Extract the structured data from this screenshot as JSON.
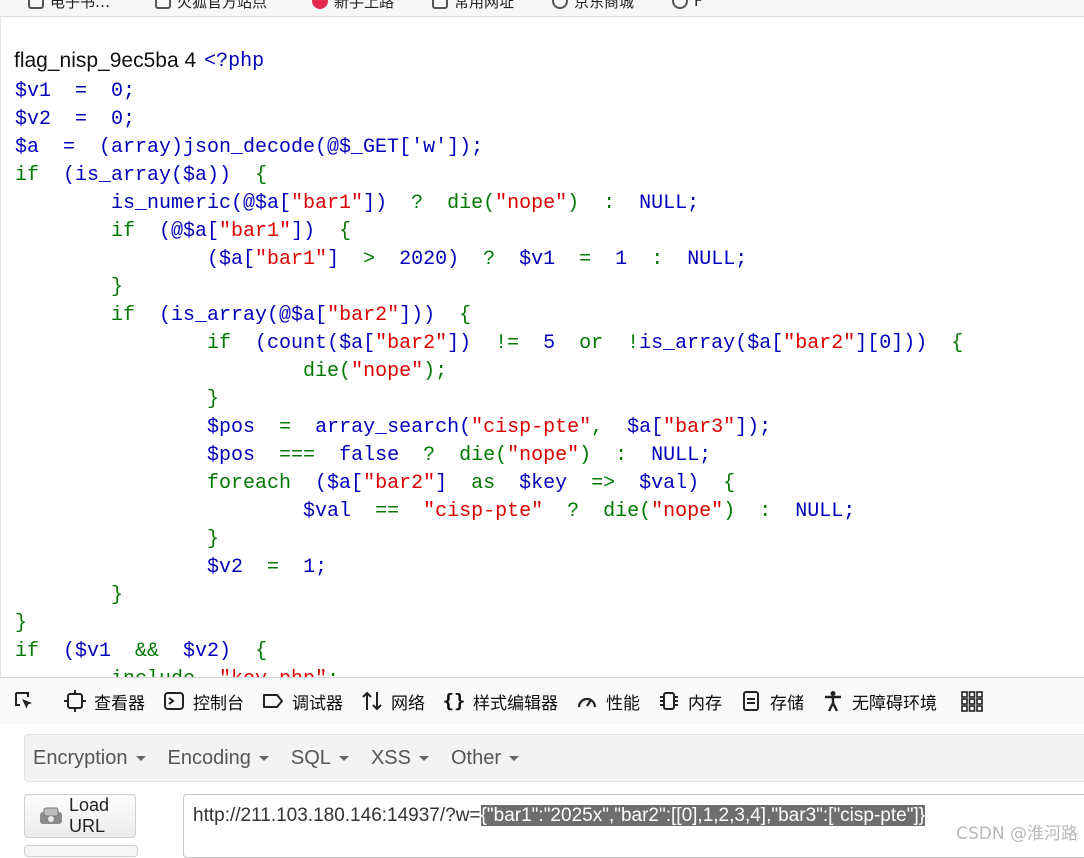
{
  "bookmarks": [
    {
      "label": "电子书…",
      "icon": "folder-icon"
    },
    {
      "label": "火狐官方站点",
      "icon": "folder-icon"
    },
    {
      "label": "新手上路",
      "icon": "firefox-icon"
    },
    {
      "label": "常用网址",
      "icon": "folder-icon"
    },
    {
      "label": "京东商城",
      "icon": "globe-icon"
    },
    {
      "label": "F",
      "icon": "globe-icon"
    }
  ],
  "page": {
    "flag_text": "flag_nisp_9ec5ba 4",
    "php_open": "<?php",
    "code": {
      "l1": "$v1  =  0;",
      "l2": "$v2  =  0;",
      "l3": "$a  =  (array)json_decode(@$_GET['w']);",
      "l4_kw": "if",
      "l4_rest": "  (is_array($a))  ",
      "l4_brace": "{",
      "l5_pre": "        is_numeric(@$a[",
      "l5_s": "\"bar1\"",
      "l5_mid": "])  ",
      "l5_q": "?",
      "l5_die": "  die(",
      "l5_s2": "\"nope\"",
      "l5_close": ")  ",
      "l5_colon": ":",
      "l5_end": "  NULL;",
      "l6_kw": "        if",
      "l6_rest": "  (@$a[",
      "l6_s": "\"bar1\"",
      "l6_close": "])  ",
      "l6_brace": "{",
      "l7_pre": "                ($a[",
      "l7_s": "\"bar1\"",
      "l7_mid": "]  ",
      "l7_gt": ">",
      "l7_num": "  2020)  ",
      "l7_q": "?",
      "l7_v": "  $v1  ",
      "l7_eq": "=",
      "l7_one": "  1  ",
      "l7_colon": ":",
      "l7_end": "  NULL;",
      "l8": "        }",
      "l9_kw": "        if",
      "l9_rest": "  (is_array(@$a[",
      "l9_s": "\"bar2\"",
      "l9_close": "]))  ",
      "l9_brace": "{",
      "l10_kw": "                if",
      "l10_rest": "  (count($a[",
      "l10_s": "\"bar2\"",
      "l10_mid": "])  ",
      "l10_ne": "!=",
      "l10_five": "  5  ",
      "l10_or": "or",
      "l10_not": "  !",
      "l10_fn": "is_array($a[",
      "l10_s2": "\"bar2\"",
      "l10_end": "][0]))  ",
      "l10_brace": "{",
      "l11_die": "                        die(",
      "l11_s": "\"nope\"",
      "l11_end": ");",
      "l12": "                }",
      "l13_v": "                $pos  ",
      "l13_eq": "=",
      "l13_fn": "  array_search(",
      "l13_s": "\"cisp-pte\"",
      "l13_comma": ",  ",
      "l13_a": "$a[",
      "l13_s2": "\"bar3\"",
      "l13_end": "]);",
      "l14_v": "                $pos  ",
      "l14_op": "===",
      "l14_false": "  false  ",
      "l14_q": "?",
      "l14_die": "  die(",
      "l14_s": "\"nope\"",
      "l14_close": ")  ",
      "l14_colon": ":",
      "l14_end": "  NULL;",
      "l15_kw": "                foreach",
      "l15_rest": "  ($a[",
      "l15_s": "\"bar2\"",
      "l15_mid": "]  ",
      "l15_as": "as",
      "l15_key": "  $key  ",
      "l15_arrow": "=>",
      "l15_val": "  $val)  ",
      "l15_brace": "{",
      "l16_v": "                        $val  ",
      "l16_eq": "==",
      "l16_sp": "  ",
      "l16_s": "\"cisp-pte\"",
      "l16_sp2": "  ",
      "l16_q": "?",
      "l16_die": "  die(",
      "l16_s2": "\"nope\"",
      "l16_close": ")  ",
      "l16_colon": ":",
      "l16_end": "  NULL;",
      "l17": "                }",
      "l18_v": "                $v2  ",
      "l18_eq": "=",
      "l18_end": "  1;",
      "l19": "        }",
      "l20": "}",
      "l21_kw": "if",
      "l21_rest": "  ($v1  ",
      "l21_and": "&&",
      "l21_v2": "  $v2)  ",
      "l21_brace": "{",
      "l22_kw": "        include",
      "l22_sp": "  ",
      "l22_s": "\"key.php\"",
      "l22_end": ";"
    }
  },
  "devtools": {
    "tabs": [
      {
        "label": "查看器",
        "icon": "inspector-icon"
      },
      {
        "label": "控制台",
        "icon": "console-icon"
      },
      {
        "label": "调试器",
        "icon": "debugger-icon"
      },
      {
        "label": "网络",
        "icon": "network-icon"
      },
      {
        "label": "样式编辑器",
        "icon": "style-editor-icon"
      },
      {
        "label": "性能",
        "icon": "performance-icon"
      },
      {
        "label": "内存",
        "icon": "memory-icon"
      },
      {
        "label": "存储",
        "icon": "storage-icon"
      },
      {
        "label": "无障碍环境",
        "icon": "accessibility-icon"
      }
    ]
  },
  "hackbar": {
    "menu": [
      "Encryption",
      "Encoding",
      "SQL",
      "XSS",
      "Other"
    ],
    "load_url": "Load URL",
    "url_prefix": "http://211.103.180.146:14937/?w=",
    "url_selected": "{\"bar1\":\"2025x\",\"bar2\":[[0],1,2,3,4],\"bar3\":[\"cisp-pte\"]}"
  },
  "watermark": "CSDN @淮河路",
  "colors": {
    "php_default": "#0000bb",
    "php_keyword": "#007700",
    "php_string": "#dd0000"
  }
}
